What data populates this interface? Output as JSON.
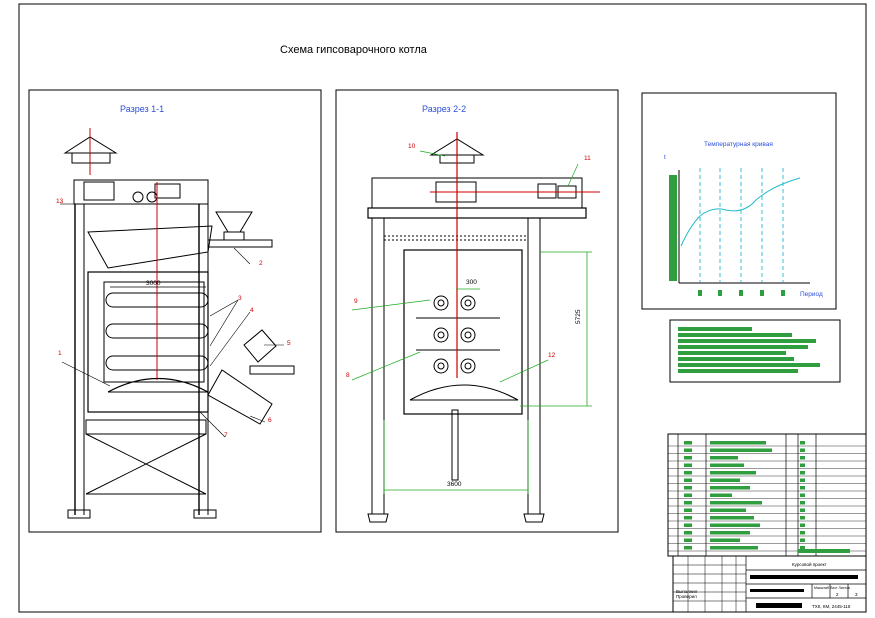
{
  "title": "Схема  гипсоварочного  котла",
  "section_1": {
    "title": "Разрез 1-1",
    "dim_width": "3000",
    "callouts": [
      "13",
      "2",
      "3",
      "4",
      "5",
      "1",
      "6",
      "7"
    ]
  },
  "section_2": {
    "title": "Разрез 2-2",
    "dim_small": "300",
    "dim_height": "5725",
    "dim_width": "3600",
    "callouts": [
      "10",
      "11",
      "9",
      "8",
      "12"
    ]
  },
  "temp_chart": {
    "title": "Температурная кривая",
    "y_label": "t",
    "x_label": "Период"
  },
  "stamp": {
    "document_title": "Курсовой проект",
    "sheet_label": "Масштаб Лист Листов",
    "sheet_no": "2",
    "sheets_total": "3",
    "code": "ТХК, КМ, 2445-118",
    "signed_by": "Выполнил Проверил"
  },
  "colors": {
    "frame": "#000000",
    "red_callout": "#cc0000",
    "green_dim": "#22aa22",
    "blue_title": "#2c4fd6",
    "cyan_curve": "#22bbcc",
    "green_block": "#2e9e3e"
  }
}
